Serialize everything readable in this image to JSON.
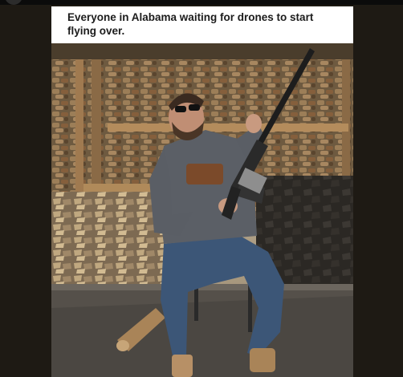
{
  "post": {
    "caption": "Everyone in Alabama waiting for drones to start flying over."
  },
  "image": {
    "icon": "meme-photo-icon"
  },
  "colors": {
    "caption_bg": "#ffffff",
    "caption_text": "#1c1c1c",
    "frame_bg": "#1e1a14"
  }
}
